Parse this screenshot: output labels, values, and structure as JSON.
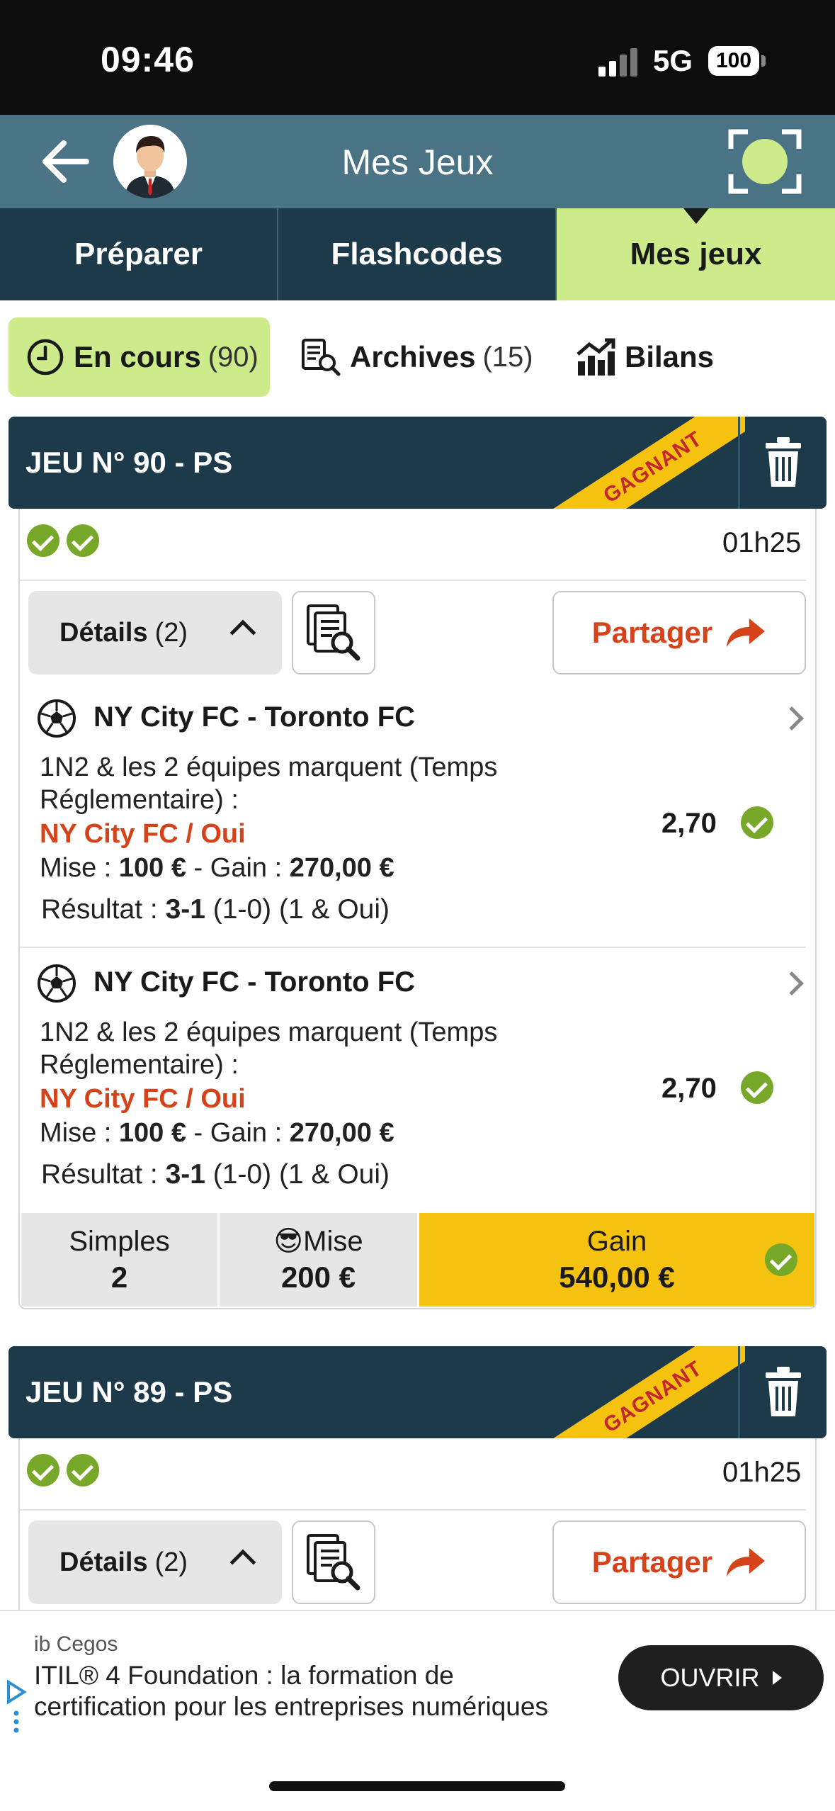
{
  "status_bar": {
    "time": "09:46",
    "network": "5G",
    "battery": "100"
  },
  "header": {
    "title": "Mes Jeux"
  },
  "tabs": [
    {
      "label": "Préparer"
    },
    {
      "label": "Flashcodes"
    },
    {
      "label": "Mes jeux",
      "active": true
    }
  ],
  "subtabs": {
    "en_cours": {
      "label": "En cours",
      "count": "(90)"
    },
    "archives": {
      "label": "Archives",
      "count": "(15)"
    },
    "bilans": {
      "label": "Bilans"
    }
  },
  "games": [
    {
      "title": "JEU N° 90 - PS",
      "ribbon": "GAGNANT",
      "time": "01h25",
      "details_label": "Détails",
      "details_count": "(2)",
      "share_label": "Partager",
      "bets": [
        {
          "match": "NY City FC - Toronto FC",
          "market_line1": "1N2 & les 2 équipes marquent (Temps",
          "market_line2": "Réglementaire) :",
          "selection": "NY City FC / Oui",
          "mise_label": "Mise : ",
          "mise_value": "100 €",
          "gain_label": " - Gain : ",
          "gain_value": "270,00 €",
          "resultat_label": "Résultat : ",
          "resultat_score": "3-1",
          "resultat_detail": " (1-0) (1 & Oui)",
          "odds": "2,70"
        },
        {
          "match": "NY City FC - Toronto FC",
          "market_line1": "1N2 & les 2 équipes marquent (Temps",
          "market_line2": "Réglementaire) :",
          "selection": "NY City FC / Oui",
          "mise_label": "Mise : ",
          "mise_value": "100 €",
          "gain_label": " - Gain : ",
          "gain_value": "270,00 €",
          "resultat_label": "Résultat : ",
          "resultat_score": "3-1",
          "resultat_detail": " (1-0) (1 & Oui)",
          "odds": "2,70"
        }
      ],
      "summary": {
        "type_label": "Simples",
        "type_value": "2",
        "mise_emoji": "😎",
        "mise_label": "Mise",
        "mise_value": "200 €",
        "gain_label": "Gain",
        "gain_value": "540,00 €"
      }
    },
    {
      "title": "JEU N° 89 - PS",
      "ribbon": "GAGNANT",
      "time": "01h25",
      "details_label": "Détails",
      "details_count": "(2)",
      "share_label": "Partager"
    }
  ],
  "ad": {
    "source": "ib Cegos",
    "line1": "ITIL® 4 Foundation : la formation de",
    "line2": "certification pour les entreprises numériques",
    "cta": "OUVRIR"
  },
  "colors": {
    "header_bg": "#4b7386",
    "tabs_bg": "#1c3a49",
    "active_green": "#cdeb8b",
    "ribbon_yellow": "#f5c30f",
    "accent_orange": "#d5431b",
    "check_green": "#78a82a"
  }
}
